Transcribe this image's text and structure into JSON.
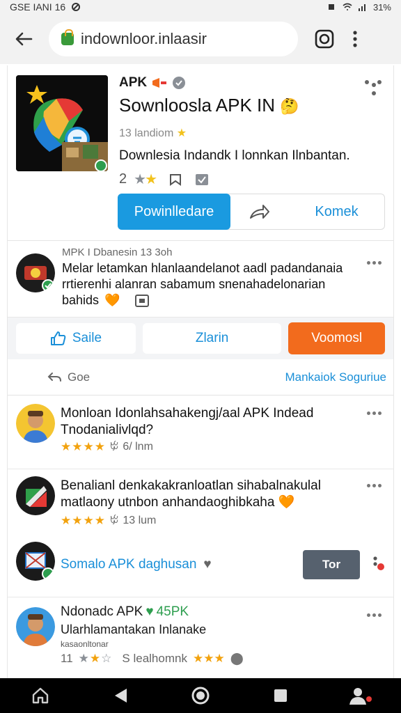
{
  "status_bar": {
    "left_text": "GSE IANI 16",
    "battery_text": "31%"
  },
  "browser": {
    "url": "indownloor.inlaasir"
  },
  "app": {
    "badge": "APK",
    "title": "Sownloosla APK IN",
    "rating_line": "13 landiom",
    "description": "Downlesia Indandk I lonnkan Ilnbantan.",
    "rating": "2",
    "download_label": "Powinlledare",
    "komek_label": "Komek"
  },
  "post": {
    "meta": "MPK I Dbanesin 13 3oh",
    "line1": "Melar letamkan hlanlaandelanot aadl padandanaia",
    "line2": "rrtierenhi alanran sabamum snenahadelonarian",
    "line3": "bahids"
  },
  "buttons": {
    "saile": "Saile",
    "zlarin": "Zlarin",
    "voomosl": "Voomosl"
  },
  "bar": {
    "left": "Goe",
    "right": "Mankaiok Soguriue"
  },
  "reviews": [
    {
      "title_line1": "Monloan Idonlahsahakengj/aal APK Indead",
      "title_line2": "Tnodanialivlqd?",
      "rating_text": "6/ lnm"
    },
    {
      "title_line1": "Benalianl denkakakranloatlan sihabalnakulal",
      "title_line2": "matlaony utnbon anhandaoghibkaha",
      "rating_text": "13 lum"
    }
  ],
  "promo": {
    "text": "Somalo APK daghusan",
    "button": "Tor"
  },
  "last_review": {
    "title": "Ndonadc APK",
    "tag": "45PK",
    "line2": "Ularhlamantakan Inlanake",
    "line3": "kasaonltonar",
    "count": "11",
    "label": "S lealhomnk"
  },
  "colors": {
    "accent_blue": "#1a9ae0",
    "orange": "#f26b1d",
    "star": "#f2a20e"
  }
}
